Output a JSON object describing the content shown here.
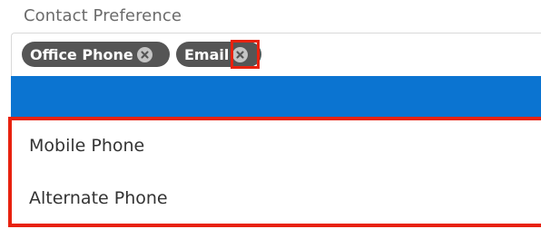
{
  "field": {
    "label": "Contact Preference"
  },
  "selected_tags": [
    {
      "label": "Office Phone",
      "remove_icon": "close-circle-icon"
    },
    {
      "label": "Email",
      "remove_icon": "close-circle-icon"
    }
  ],
  "options": [
    {
      "label": "Mobile Phone"
    },
    {
      "label": "Alternate Phone"
    }
  ],
  "colors": {
    "highlight": "#e8220f",
    "selected_bar": "#0b74d1",
    "pill": "#555555",
    "pill_remove": "#c4c4c4"
  }
}
